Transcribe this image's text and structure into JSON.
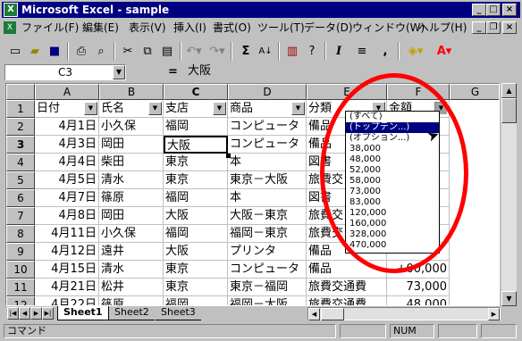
{
  "window": {
    "title": "Microsoft Excel - sample"
  },
  "menu": [
    "ファイル(F)",
    "編集(E)",
    "表示(V)",
    "挿入(I)",
    "書式(O)",
    "ツール(T)",
    "データ(D)",
    "ウィンドウ(W)",
    "ヘルプ(H)"
  ],
  "toolbar": {
    "sum": "Σ",
    "bold": "B",
    "italic": "I",
    "comma": ","
  },
  "formula": {
    "cell_ref": "C3",
    "equals": "=",
    "content": "大阪"
  },
  "columns": [
    "A",
    "B",
    "C",
    "D",
    "E",
    "F",
    "G"
  ],
  "rows": [
    [
      "日付",
      "氏名",
      "支店",
      "商品",
      "分類",
      "金額"
    ],
    [
      "4月1日",
      "小久保",
      "福岡",
      "コンピュータ",
      "備品",
      ""
    ],
    [
      "4月3日",
      "岡田",
      "大阪",
      "コンピュータ",
      "備品",
      ""
    ],
    [
      "4月4日",
      "柴田",
      "東京",
      "本",
      "図書",
      ""
    ],
    [
      "4月5日",
      "清水",
      "東京",
      "東京－大阪",
      "旅費交",
      ""
    ],
    [
      "4月7日",
      "篠原",
      "福岡",
      "本",
      "図書",
      ""
    ],
    [
      "4月8日",
      "岡田",
      "大阪",
      "大阪－東京",
      "旅費交",
      ""
    ],
    [
      "4月11日",
      "小久保",
      "福岡",
      "福岡－東京",
      "旅費交",
      ""
    ],
    [
      "4月12日",
      "遠井",
      "大阪",
      "プリンタ",
      "備品",
      ""
    ],
    [
      "4月15日",
      "清水",
      "東京",
      "コンピュータ",
      "備品",
      "+00,000"
    ],
    [
      "4月21日",
      "松井",
      "東京",
      "東京－福岡",
      "旅費交通費",
      "73,000"
    ],
    [
      "4月22日",
      "篠原",
      "福岡",
      "福岡－大阪",
      "旅費交通費",
      "48,000"
    ]
  ],
  "filter_dropdown": {
    "options": [
      "(すべて)",
      "(トップテン...)",
      "(オプション...)",
      "38,000",
      "48,000",
      "52,000",
      "58,000",
      "73,000",
      "83,000",
      "120,000",
      "160,000",
      "328,000",
      "470,000"
    ],
    "selected_index": 1
  },
  "sheets": [
    "Sheet1",
    "Sheet2",
    "Sheet3"
  ],
  "active_sheet": "Sheet1",
  "status": {
    "mode": "コマンド",
    "num": "NUM"
  }
}
